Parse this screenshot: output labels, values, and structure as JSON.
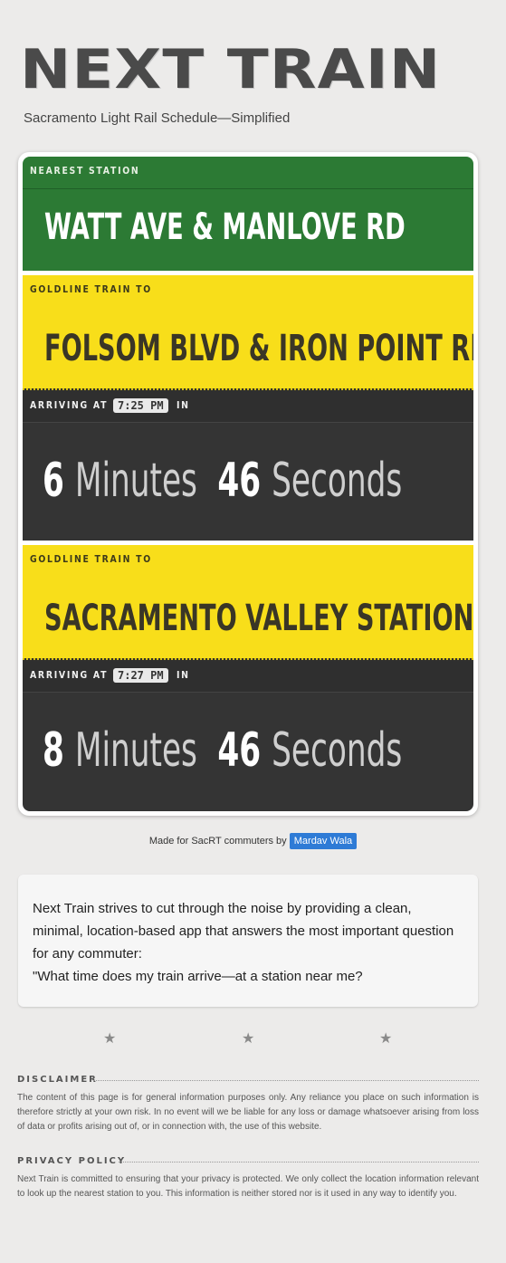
{
  "header": {
    "logo_text": "NEXT TRAIN",
    "tagline": "Sacramento Light Rail Schedule—Simplified"
  },
  "nearest": {
    "label": "NEAREST STATION",
    "station": "WATT AVE & MANLOVE RD"
  },
  "trains": [
    {
      "label": "GOLDLINE TRAIN TO",
      "destination": "FOLSOM BLVD & IRON POINT RD",
      "arriving_label": "ARRIVING AT",
      "time": "7:25 PM",
      "in_label": "IN",
      "minutes": "6",
      "minutes_unit": "Minutes",
      "seconds": "46",
      "seconds_unit": "Seconds"
    },
    {
      "label": "GOLDLINE TRAIN TO",
      "destination": "SACRAMENTO VALLEY STATION",
      "arriving_label": "ARRIVING AT",
      "time": "7:27 PM",
      "in_label": "IN",
      "minutes": "8",
      "minutes_unit": "Minutes",
      "seconds": "46",
      "seconds_unit": "Seconds"
    }
  ],
  "credit": {
    "text": "Made for SacRT commuters by",
    "author": "Mardav Wala"
  },
  "about": {
    "text": "Next Train strives to cut through the noise by providing a clean, minimal, location-based app that answers the most important question for any commuter:",
    "quote": "\"What time does my train arrive—at a station near me?"
  },
  "stars": [
    "★",
    "★",
    "★"
  ],
  "legal": {
    "disclaimer_title": "DISCLAIMER",
    "disclaimer_text": "The content of this page is for general information purposes only. Any reliance you place on such information is therefore strictly at your own risk. In no event will we be liable for any loss or damage whatsoever arising from loss of data or profits arising out of, or in connection with, the use of this website.",
    "privacy_title": "PRIVACY POLICY",
    "privacy_text": "Next Train is committed to ensuring that your privacy is protected. We only collect the location information relevant to look up the nearest station to you. This information is neither stored nor is it used in any way to identify you."
  },
  "colors": {
    "nearest_bg": "#2c7a34",
    "train_bg": "#f8de1a",
    "countdown_bg": "#343434",
    "author_badge": "#2e7bd6"
  }
}
